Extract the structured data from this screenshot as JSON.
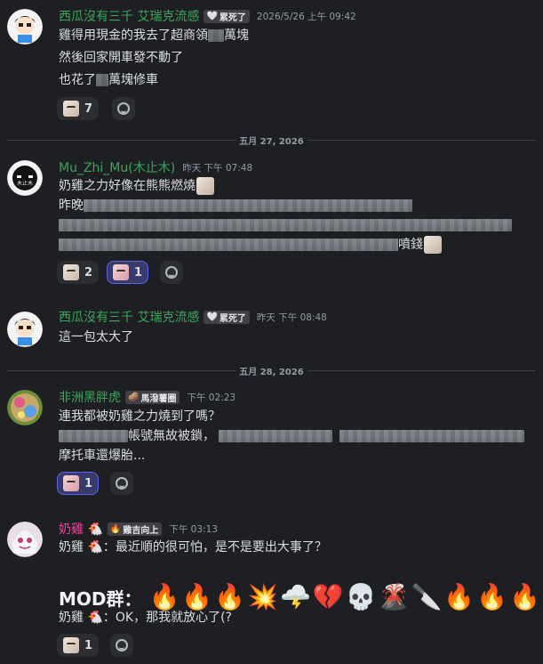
{
  "messages": {
    "m1": {
      "username": "西瓜沒有三千 艾瑞克流感",
      "username_color": "#3ba55c",
      "tag_icon": "heart-icon",
      "tag": "累死了",
      "timestamp": "2026/5/26 上午 09:42",
      "lines": [
        "雞得用現金的我去了超商領",
        "萬塊",
        "然後回家開車發不動了",
        "也花了",
        "萬塊修車"
      ],
      "reaction_count": "7"
    },
    "divider1": "五月 27, 2026",
    "m2": {
      "username": "Mu_Zhi_Mu(木止木)",
      "username_color": "#3ba55c",
      "timestamp": "昨天 下午 07:48",
      "line1": "奶雞之力好像在熊熊燃燒",
      "line2_prefix": "昨晚",
      "line3_suffix": "噴錢",
      "reactions": [
        {
          "count": "2"
        },
        {
          "count": "1"
        }
      ]
    },
    "m3": {
      "username": "西瓜沒有三千 艾瑞克流感",
      "tag": "累死了",
      "timestamp": "昨天 下午 08:48",
      "line1": "這一包太大了"
    },
    "divider2": "五月 28, 2026",
    "m4": {
      "username": "非洲黑胖虎",
      "username_color": "#3ba55c",
      "tag": "馬潑薯圈",
      "timestamp": "下午 02:23",
      "line1": "連我都被奶雞之力燒到了嗎？",
      "line2_mid": "帳號無故被鎖，",
      "line3": "摩托車還爆胎...",
      "reaction_count": "1"
    },
    "m5": {
      "username": "奶雞",
      "username_color": "#eb459e",
      "tag": "雞吉向上",
      "timestamp": "下午 03:13",
      "line1_a": "奶雞",
      "line1_b": "：最近順的很可怕，是不是要出大事了？",
      "mod_label": "MOD群：",
      "mod_emojis": [
        "🔥",
        "🔥",
        "🔥",
        "💥",
        "🌩️",
        "💔",
        "💀",
        "🌋",
        "🔪",
        "🔥",
        "🔥",
        "🔥"
      ],
      "line3_a": "奶雞",
      "line3_b": "：OK，那我就放心了(?",
      "reaction_count": "1"
    }
  }
}
